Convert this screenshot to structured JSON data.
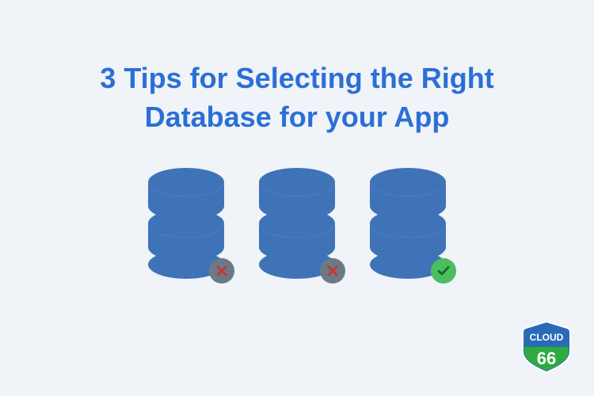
{
  "title_line1": "3 Tips for Selecting the Right",
  "title_line2": "Database for your App",
  "databases": [
    {
      "status": "rejected"
    },
    {
      "status": "rejected"
    },
    {
      "status": "accepted"
    }
  ],
  "logo": {
    "top_text": "CLOUD",
    "bottom_text": "66"
  },
  "colors": {
    "background": "#f0f3f7",
    "primary": "#2b6fd6",
    "db_fill": "#3e73b8",
    "badge_x_bg": "#6b7a86",
    "badge_x_fg": "#c13a3a",
    "badge_check_bg": "#4bbf5f",
    "logo_blue": "#2a6bb8",
    "logo_green": "#2eab3f"
  }
}
